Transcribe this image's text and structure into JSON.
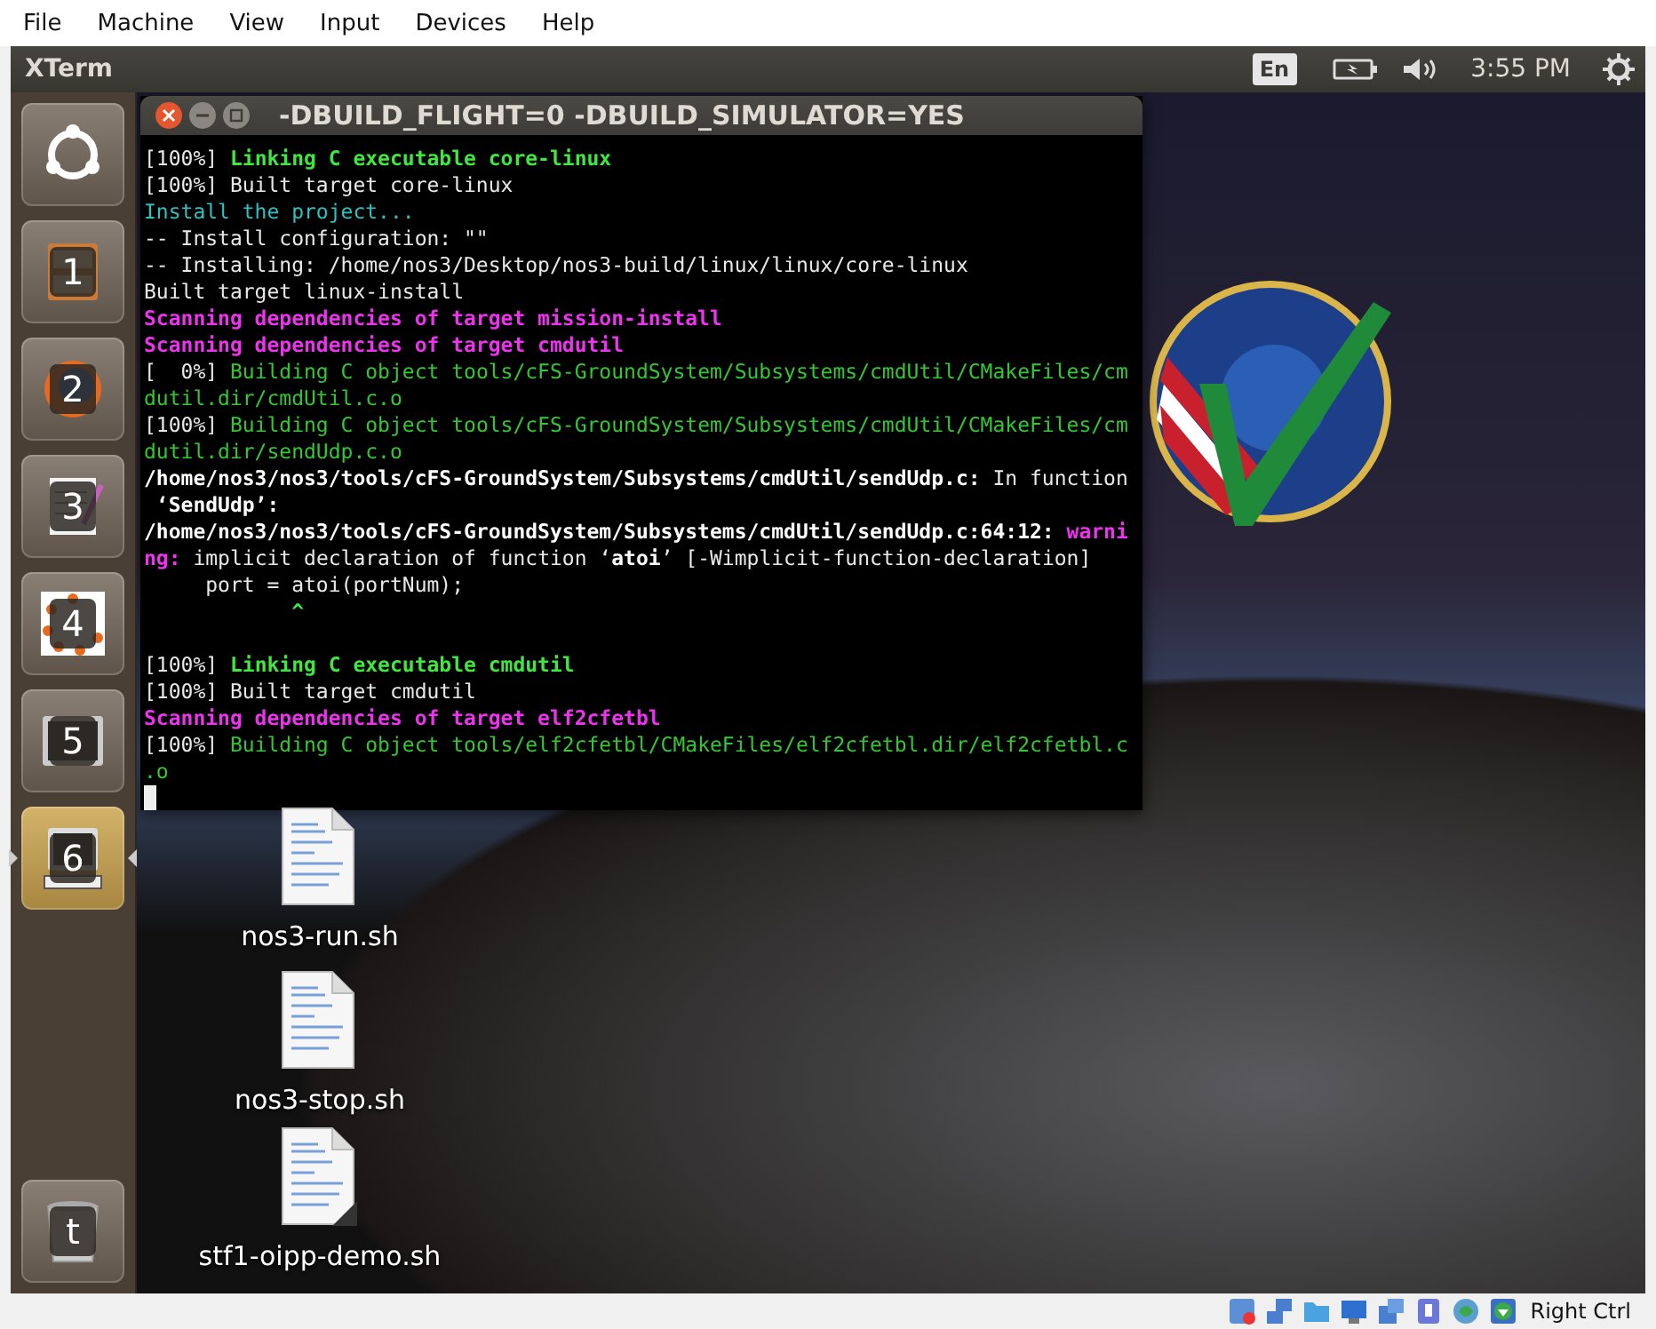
{
  "host_menu": [
    "File",
    "Machine",
    "View",
    "Input",
    "Devices",
    "Help"
  ],
  "top_panel": {
    "app_title": "XTerm",
    "keyboard_layout": "En",
    "clock": "3:55 PM"
  },
  "launcher": [
    {
      "kind": "dash",
      "selected": false
    },
    {
      "kind": "files",
      "shortcut": "1",
      "selected": false
    },
    {
      "kind": "browser",
      "shortcut": "2",
      "selected": false
    },
    {
      "kind": "editor",
      "shortcut": "3",
      "selected": false
    },
    {
      "kind": "dots",
      "shortcut": "4",
      "selected": false
    },
    {
      "kind": "terminal",
      "shortcut": "5",
      "selected": false
    },
    {
      "kind": "xterm",
      "shortcut": "6",
      "selected": true
    },
    {
      "kind": "trash",
      "shortcut": "t",
      "selected": false
    }
  ],
  "terminal": {
    "title": "-DBUILD_FLIGHT=0 -DBUILD_SIMULATOR=YES",
    "lines": [
      {
        "kind": "text",
        "segments": [
          {
            "kind": "plain",
            "text": "[100%] "
          },
          {
            "kind": "green-bold",
            "text": "Linking C executable core-linux"
          }
        ]
      },
      {
        "kind": "text",
        "segments": [
          {
            "kind": "plain",
            "text": "[100%] Built target core-linux"
          }
        ]
      },
      {
        "kind": "text",
        "segments": [
          {
            "kind": "cyan",
            "text": "Install the project..."
          }
        ]
      },
      {
        "kind": "text",
        "segments": [
          {
            "kind": "plain",
            "text": "-- Install configuration: \"\""
          }
        ]
      },
      {
        "kind": "text",
        "segments": [
          {
            "kind": "plain",
            "text": "-- Installing: /home/nos3/Desktop/nos3-build/linux/linux/core-linux"
          }
        ]
      },
      {
        "kind": "text",
        "segments": [
          {
            "kind": "plain",
            "text": "Built target linux-install"
          }
        ]
      },
      {
        "kind": "text",
        "segments": [
          {
            "kind": "magenta-bold",
            "text": "Scanning dependencies of target mission-install"
          }
        ]
      },
      {
        "kind": "text",
        "segments": [
          {
            "kind": "magenta-bold",
            "text": "Scanning dependencies of target cmdutil"
          }
        ]
      },
      {
        "kind": "text",
        "segments": [
          {
            "kind": "plain",
            "text": "[  0%] "
          },
          {
            "kind": "green",
            "text": "Building C object tools/cFS-GroundSystem/Subsystems/cmdUtil/CMakeFiles/cm"
          }
        ]
      },
      {
        "kind": "text",
        "segments": [
          {
            "kind": "green",
            "text": "dutil.dir/cmdUtil.c.o"
          }
        ]
      },
      {
        "kind": "text",
        "segments": [
          {
            "kind": "plain",
            "text": "[100%] "
          },
          {
            "kind": "green",
            "text": "Building C object tools/cFS-GroundSystem/Subsystems/cmdUtil/CMakeFiles/cm"
          }
        ]
      },
      {
        "kind": "text",
        "segments": [
          {
            "kind": "green",
            "text": "dutil.dir/sendUdp.c.o"
          }
        ]
      },
      {
        "kind": "text",
        "segments": [
          {
            "kind": "white-bold",
            "text": "/home/nos3/nos3/tools/cFS-GroundSystem/Subsystems/cmdUtil/sendUdp.c:"
          },
          {
            "kind": "plain",
            "text": " In function"
          }
        ]
      },
      {
        "kind": "text",
        "segments": [
          {
            "kind": "white-bold",
            "text": " ‘SendUdp’:"
          }
        ]
      },
      {
        "kind": "text",
        "segments": [
          {
            "kind": "white-bold",
            "text": "/home/nos3/nos3/tools/cFS-GroundSystem/Subsystems/cmdUtil/sendUdp.c:64:12: "
          },
          {
            "kind": "magenta-bold",
            "text": "warni"
          }
        ]
      },
      {
        "kind": "text",
        "segments": [
          {
            "kind": "magenta-bold",
            "text": "ng:"
          },
          {
            "kind": "plain",
            "text": " implicit declaration of function ‘"
          },
          {
            "kind": "white-bold",
            "text": "atoi"
          },
          {
            "kind": "plain",
            "text": "’ [-Wimplicit-function-declaration]"
          }
        ]
      },
      {
        "kind": "text",
        "segments": [
          {
            "kind": "plain",
            "text": "     port = atoi(portNum);"
          }
        ]
      },
      {
        "kind": "text",
        "segments": [
          {
            "kind": "green-bold",
            "text": "            ^"
          }
        ]
      },
      {
        "kind": "blank"
      },
      {
        "kind": "text",
        "segments": [
          {
            "kind": "plain",
            "text": "[100%] "
          },
          {
            "kind": "green-bold",
            "text": "Linking C executable cmdutil"
          }
        ]
      },
      {
        "kind": "text",
        "segments": [
          {
            "kind": "plain",
            "text": "[100%] Built target cmdutil"
          }
        ]
      },
      {
        "kind": "text",
        "segments": [
          {
            "kind": "magenta-bold",
            "text": "Scanning dependencies of target elf2cfetbl"
          }
        ]
      },
      {
        "kind": "text",
        "segments": [
          {
            "kind": "plain",
            "text": "[100%] "
          },
          {
            "kind": "green",
            "text": "Building C object tools/elf2cfetbl/CMakeFiles/elf2cfetbl.dir/elf2cfetbl.c"
          }
        ]
      },
      {
        "kind": "text",
        "segments": [
          {
            "kind": "green",
            "text": ".o"
          }
        ]
      },
      {
        "kind": "cursor"
      }
    ]
  },
  "desktop_files": [
    {
      "name": "nos3-run.sh",
      "link": false
    },
    {
      "name": "nos3-stop.sh",
      "link": false
    },
    {
      "name": "stf1-oipp-demo.sh",
      "link": true
    }
  ],
  "status_bar": {
    "host_key": "Right Ctrl"
  }
}
